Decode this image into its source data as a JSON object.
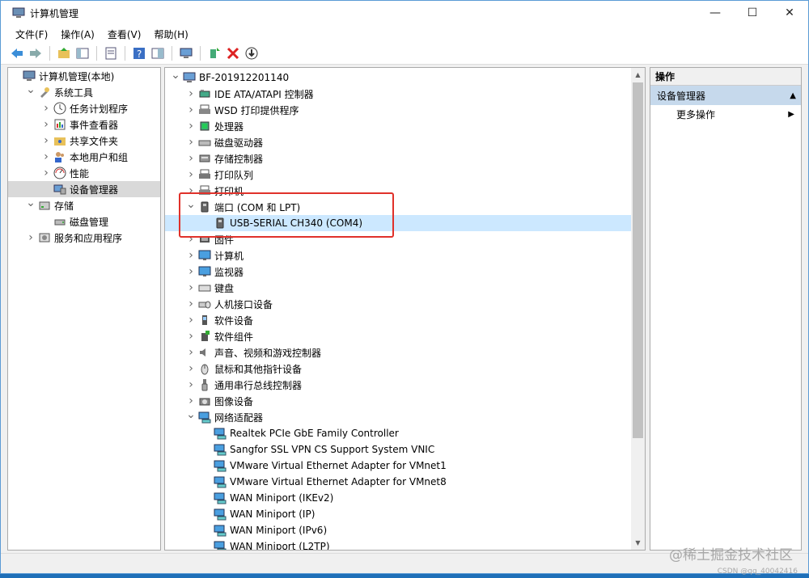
{
  "window": {
    "title": "计算机管理"
  },
  "menu": [
    "文件(F)",
    "操作(A)",
    "查看(V)",
    "帮助(H)"
  ],
  "left_tree": [
    {
      "label": "计算机管理(本地)",
      "indent": 0,
      "exp": "",
      "icon": "computer-management-icon"
    },
    {
      "label": "系统工具",
      "indent": 1,
      "exp": "v",
      "icon": "tools-icon"
    },
    {
      "label": "任务计划程序",
      "indent": 2,
      "exp": ">",
      "icon": "clock-icon"
    },
    {
      "label": "事件查看器",
      "indent": 2,
      "exp": ">",
      "icon": "event-viewer-icon"
    },
    {
      "label": "共享文件夹",
      "indent": 2,
      "exp": ">",
      "icon": "shared-folder-icon"
    },
    {
      "label": "本地用户和组",
      "indent": 2,
      "exp": ">",
      "icon": "users-icon"
    },
    {
      "label": "性能",
      "indent": 2,
      "exp": ">",
      "icon": "performance-icon"
    },
    {
      "label": "设备管理器",
      "indent": 2,
      "exp": "",
      "icon": "device-manager-icon",
      "selected": true
    },
    {
      "label": "存储",
      "indent": 1,
      "exp": "v",
      "icon": "storage-icon"
    },
    {
      "label": "磁盘管理",
      "indent": 2,
      "exp": "",
      "icon": "disk-icon"
    },
    {
      "label": "服务和应用程序",
      "indent": 1,
      "exp": ">",
      "icon": "services-icon"
    }
  ],
  "device_tree": [
    {
      "label": "BF-201912201140",
      "indent": 0,
      "exp": "v",
      "icon": "computer-icon"
    },
    {
      "label": "IDE ATA/ATAPI 控制器",
      "indent": 1,
      "exp": ">",
      "icon": "ide-controller-icon"
    },
    {
      "label": "WSD 打印提供程序",
      "indent": 1,
      "exp": ">",
      "icon": "printer-icon"
    },
    {
      "label": "处理器",
      "indent": 1,
      "exp": ">",
      "icon": "processor-icon"
    },
    {
      "label": "磁盘驱动器",
      "indent": 1,
      "exp": ">",
      "icon": "disk-drive-icon"
    },
    {
      "label": "存储控制器",
      "indent": 1,
      "exp": ">",
      "icon": "storage-controller-icon"
    },
    {
      "label": "打印队列",
      "indent": 1,
      "exp": ">",
      "icon": "print-queue-icon"
    },
    {
      "label": "打印机",
      "indent": 1,
      "exp": ">",
      "icon": "printer-icon"
    },
    {
      "label": "端口 (COM 和 LPT)",
      "indent": 1,
      "exp": "v",
      "icon": "port-icon"
    },
    {
      "label": "USB-SERIAL CH340 (COM4)",
      "indent": 2,
      "exp": "",
      "icon": "port-icon",
      "selected": true
    },
    {
      "label": "固件",
      "indent": 1,
      "exp": ">",
      "icon": "firmware-icon"
    },
    {
      "label": "计算机",
      "indent": 1,
      "exp": ">",
      "icon": "monitor-icon"
    },
    {
      "label": "监视器",
      "indent": 1,
      "exp": ">",
      "icon": "monitor-icon"
    },
    {
      "label": "键盘",
      "indent": 1,
      "exp": ">",
      "icon": "keyboard-icon"
    },
    {
      "label": "人机接口设备",
      "indent": 1,
      "exp": ">",
      "icon": "hid-icon"
    },
    {
      "label": "软件设备",
      "indent": 1,
      "exp": ">",
      "icon": "software-device-icon"
    },
    {
      "label": "软件组件",
      "indent": 1,
      "exp": ">",
      "icon": "software-component-icon"
    },
    {
      "label": "声音、视频和游戏控制器",
      "indent": 1,
      "exp": ">",
      "icon": "speaker-icon"
    },
    {
      "label": "鼠标和其他指针设备",
      "indent": 1,
      "exp": ">",
      "icon": "mouse-icon"
    },
    {
      "label": "通用串行总线控制器",
      "indent": 1,
      "exp": ">",
      "icon": "usb-icon"
    },
    {
      "label": "图像设备",
      "indent": 1,
      "exp": ">",
      "icon": "camera-icon"
    },
    {
      "label": "网络适配器",
      "indent": 1,
      "exp": "v",
      "icon": "network-icon"
    },
    {
      "label": "Realtek PCIe GbE Family Controller",
      "indent": 2,
      "exp": "",
      "icon": "network-icon"
    },
    {
      "label": "Sangfor SSL VPN CS Support System VNIC",
      "indent": 2,
      "exp": "",
      "icon": "network-icon"
    },
    {
      "label": "VMware Virtual Ethernet Adapter for VMnet1",
      "indent": 2,
      "exp": "",
      "icon": "network-icon"
    },
    {
      "label": "VMware Virtual Ethernet Adapter for VMnet8",
      "indent": 2,
      "exp": "",
      "icon": "network-icon"
    },
    {
      "label": "WAN Miniport (IKEv2)",
      "indent": 2,
      "exp": "",
      "icon": "network-icon"
    },
    {
      "label": "WAN Miniport (IP)",
      "indent": 2,
      "exp": "",
      "icon": "network-icon"
    },
    {
      "label": "WAN Miniport (IPv6)",
      "indent": 2,
      "exp": "",
      "icon": "network-icon"
    },
    {
      "label": "WAN Miniport (L2TP)",
      "indent": 2,
      "exp": "",
      "icon": "network-icon"
    }
  ],
  "actions": {
    "header": "操作",
    "section": "设备管理器",
    "more": "更多操作"
  },
  "watermark": "@稀土掘金技术社区",
  "watermark2": "CSDN @qq_40042416",
  "colors": {
    "highlight": "#e0312a",
    "selection": "#cce8ff",
    "action_section": "#c6d9ec"
  }
}
